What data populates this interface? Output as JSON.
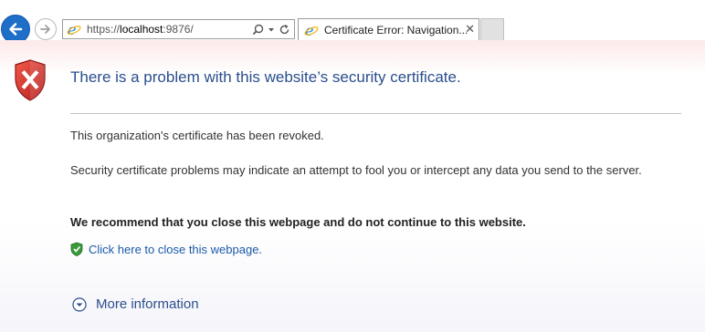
{
  "browser": {
    "address": {
      "scheme": "https://",
      "host": "localhost",
      "rest": ":9876/"
    },
    "tab": {
      "title": "Certificate Error: Navigation...",
      "close_glyph": "✕"
    },
    "icons": {
      "back": "back-arrow-icon",
      "forward": "forward-arrow-icon",
      "page": "ie-logo-icon",
      "search": "search-icon",
      "dropdown": "chevron-down-icon",
      "refresh": "refresh-icon",
      "new_tab": "new-tab-icon"
    }
  },
  "page": {
    "title": "There is a problem with this website’s security certificate.",
    "revoked_text": "This organization's certificate has been revoked.",
    "warning_text": "Security certificate problems may indicate an attempt to fool you or intercept any data you send to the server.",
    "recommend_text": "We recommend that you close this webpage and do not continue to this website.",
    "close_link": "Click here to close this webpage.",
    "more_info": "More information"
  },
  "colors": {
    "title_blue": "#2a4e8c",
    "link_blue": "#1a5aa8",
    "back_button": "#1e6fc8",
    "error_shield": "#c62828",
    "safe_shield": "#3a9a3a"
  }
}
